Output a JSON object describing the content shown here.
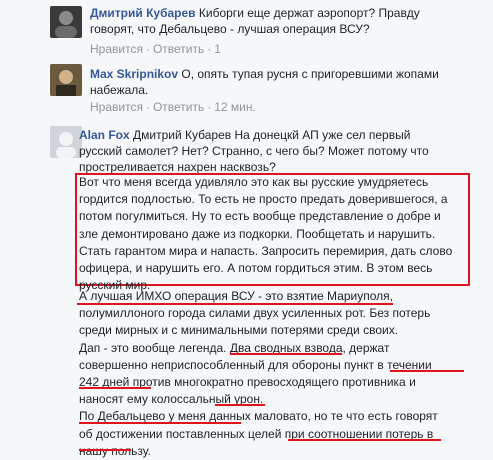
{
  "comments": [
    {
      "author": "Дмитрий Кубарев",
      "lines": [
        " Киборги еще держат аэропорт? Правду",
        "говорят, что Дебальцево - лучшая операция ВСУ?"
      ],
      "actions": [
        "Нравится",
        "Ответить",
        "1"
      ]
    },
    {
      "author": "Max Skripnikov",
      "lines": [
        " О, опять тупая русня с пригоревшими жопами",
        "набежала."
      ],
      "actions": [
        "Нравится",
        "Ответить",
        "12 мин."
      ]
    },
    {
      "author": "Alan Fox",
      "lines": [
        " Дмитрий Кубарев На донецкй АП уже сел первый",
        "русский самолет? Нет? Странно, с чего бы? Может потому что",
        "простреливается нахрен насквозь?"
      ],
      "boxed_lines": [
        "Вот что меня всегда удивляло это как вы русские умудряетесь",
        "гордится подлостью. То есть не просто предать доверившегося, а",
        "потом погулмиться. Ну то есть вообще представление о добре и",
        "зле демонтировано даже из подкорки. Пообщетать и нарушить.",
        "Стать гарантом мира и напасть. Запросить перемирия, дать слово",
        "офицера, и нарушить его. А потом гордиться этим. В этом весь",
        "русский мир."
      ],
      "para_lines": [
        "А лучшая ИМХО операция ВСУ - это взятие Мариуполя,",
        "полумиллоного города силами двух усиленных рот. Без потерь",
        "среди мирных и с минимальными потерями среди своих.",
        "Дап - это вообще легенда. Два сводных взвода, держат",
        "совершенно неприспособленный для обороны пункт в течении",
        "242 дней против многократно превосходящего противника и",
        "наносят ему колоссальный урон.",
        "По Дебальцево у меня данных маловато, но те что есть говорят",
        "об достижении поставленных целей при соотношении потерь в",
        "нашу пользу."
      ]
    }
  ],
  "colors": {
    "author": "#365899",
    "meta": "#90949c",
    "highlight": "#e0141e"
  }
}
